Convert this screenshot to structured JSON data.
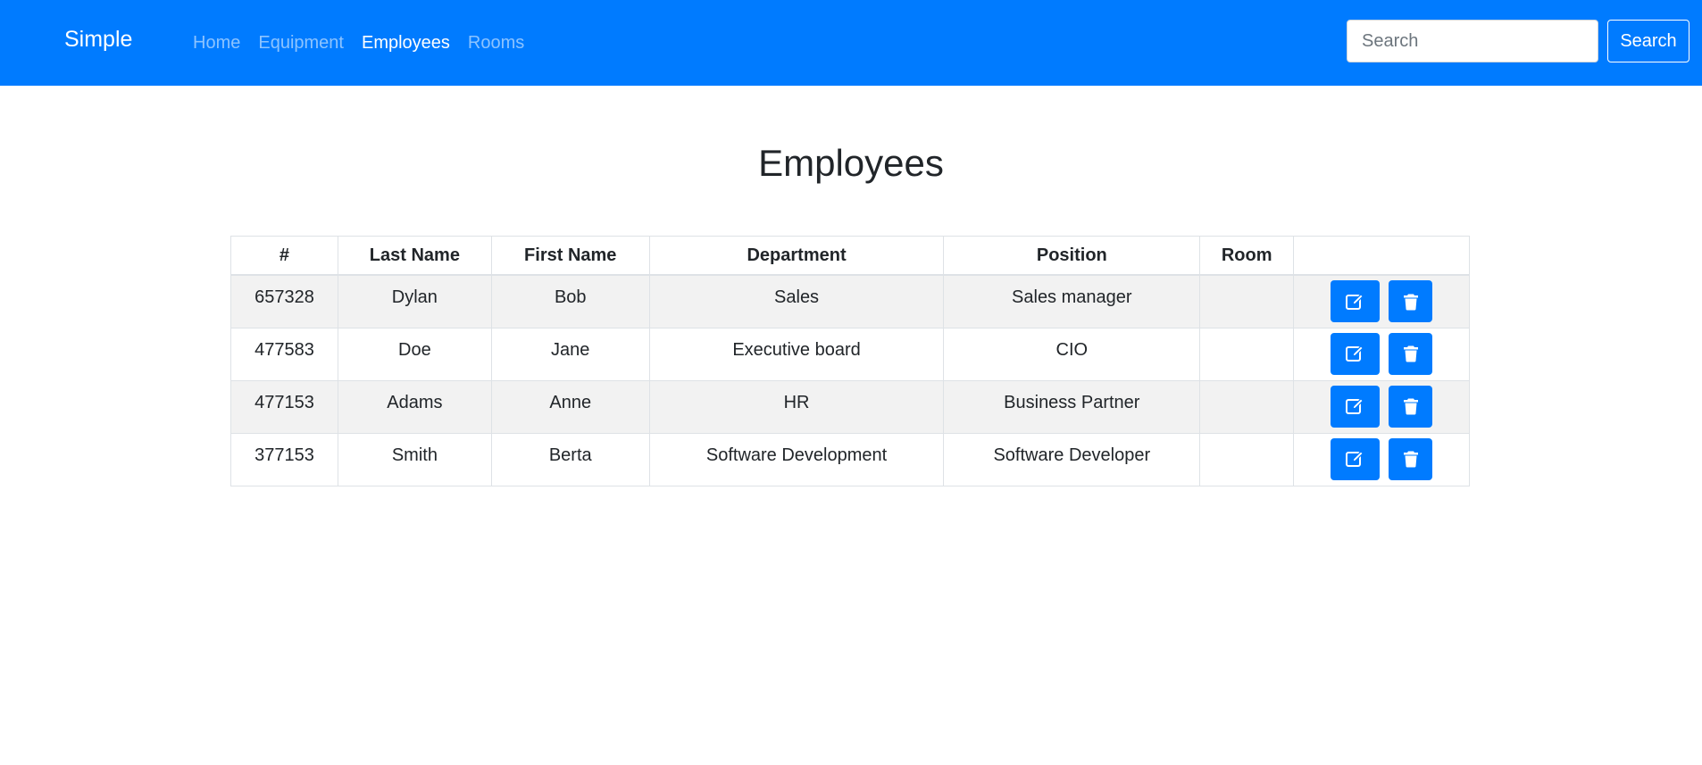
{
  "navbar": {
    "brand": "Simple",
    "links": [
      {
        "label": "Home",
        "active": false
      },
      {
        "label": "Equipment",
        "active": false
      },
      {
        "label": "Employees",
        "active": true
      },
      {
        "label": "Rooms",
        "active": false
      }
    ],
    "search": {
      "placeholder": "Search",
      "value": "",
      "button_label": "Search"
    }
  },
  "main": {
    "title": "Employees",
    "table": {
      "headers": [
        "#",
        "Last Name",
        "First Name",
        "Department",
        "Position",
        "Room",
        ""
      ],
      "rows": [
        {
          "id": "657328",
          "last_name": "Dylan",
          "first_name": "Bob",
          "department": "Sales",
          "position": "Sales manager",
          "room": ""
        },
        {
          "id": "477583",
          "last_name": "Doe",
          "first_name": "Jane",
          "department": "Executive board",
          "position": "CIO",
          "room": ""
        },
        {
          "id": "477153",
          "last_name": "Adams",
          "first_name": "Anne",
          "department": "HR",
          "position": "Business Partner",
          "room": ""
        },
        {
          "id": "377153",
          "last_name": "Smith",
          "first_name": "Berta",
          "department": "Software Development",
          "position": "Software Developer",
          "room": ""
        }
      ],
      "row_actions": [
        {
          "icon": "edit-icon"
        },
        {
          "icon": "trash-icon"
        }
      ]
    }
  },
  "colors": {
    "primary": "#007bff",
    "striped_row": "#f2f2f2",
    "border": "#dee2e6",
    "text": "#212529"
  }
}
